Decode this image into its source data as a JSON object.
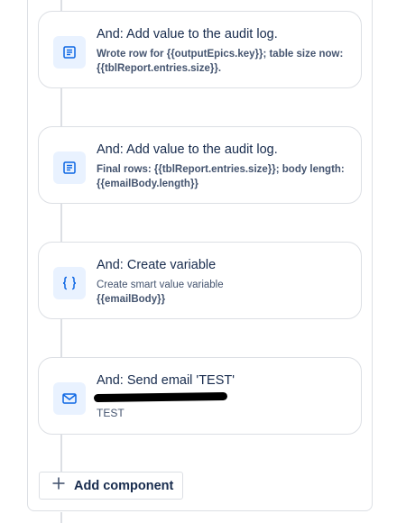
{
  "steps": [
    {
      "icon": "document-icon",
      "title": "And: Add value to the audit log.",
      "description": "Wrote row for {{outputEpics.key}}; table size now: {{tblReport.entries.size}}."
    },
    {
      "icon": "document-icon",
      "title": "And: Add value to the audit log.",
      "description": "Final rows: {{tblReport.entries.size}}; body length: {{emailBody.length}}"
    },
    {
      "icon": "braces-icon",
      "title": "And: Create variable",
      "description_line1": "Create smart value variable",
      "description_line2": "{{emailBody}}"
    },
    {
      "icon": "mail-icon",
      "title": "And: Send email 'TEST'",
      "subtitle": "TEST"
    }
  ],
  "add_component": {
    "label": "Add component",
    "icon": "plus-icon"
  },
  "colors": {
    "accent": "#0c66e4",
    "icon_bg": "#e9f2ff",
    "border": "#dcdfe4"
  }
}
